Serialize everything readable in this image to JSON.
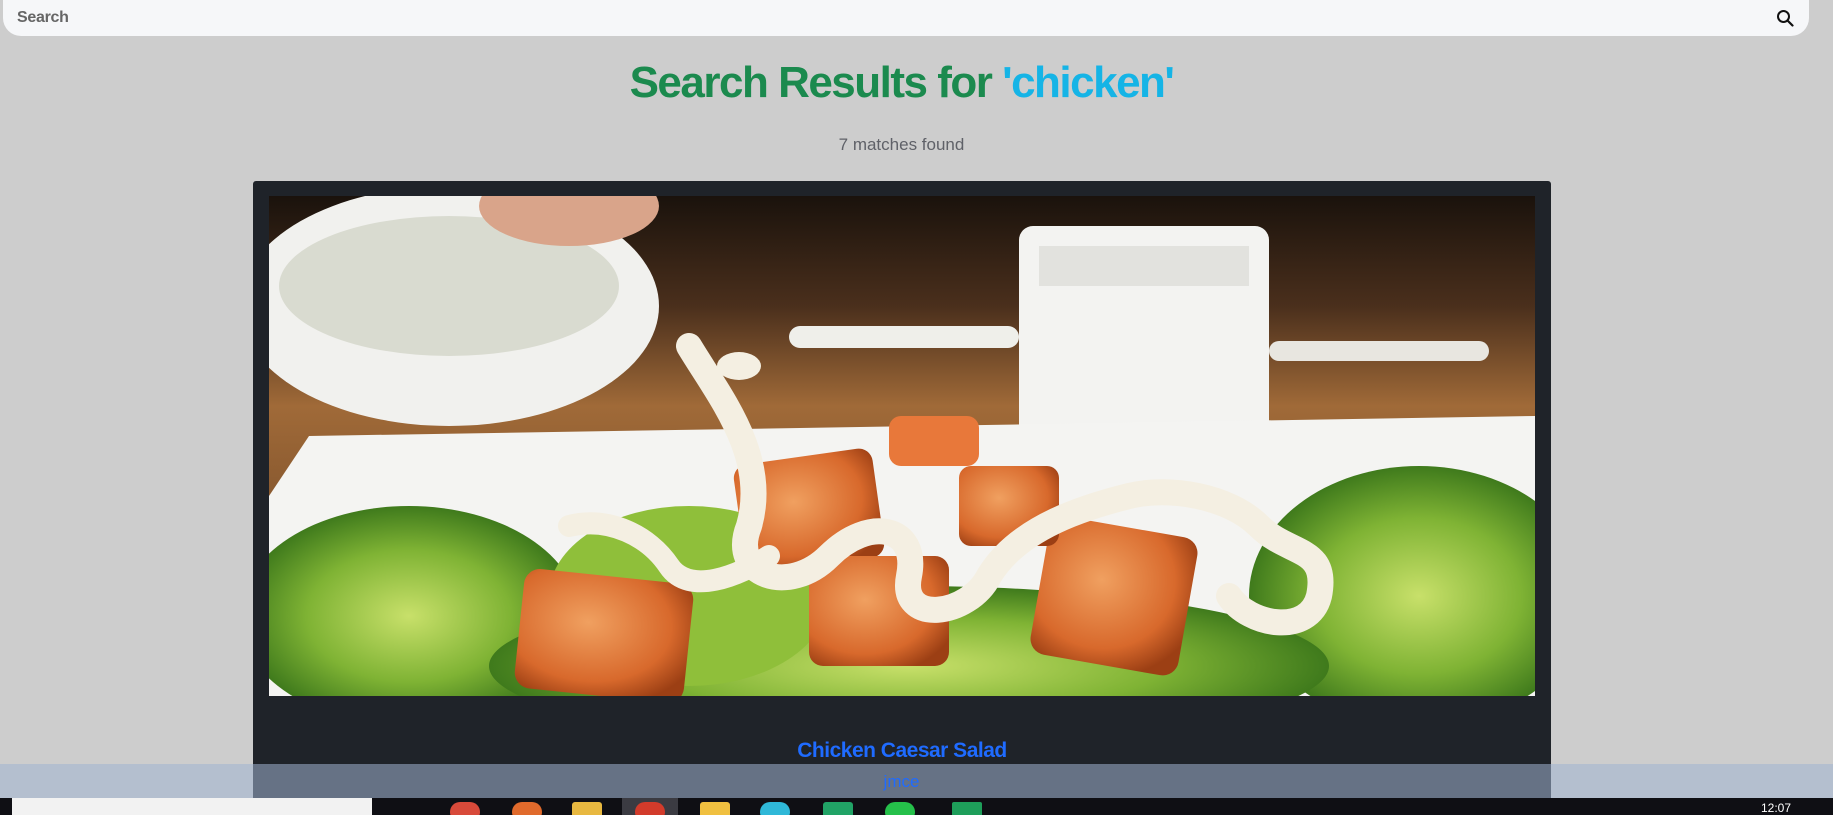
{
  "search": {
    "placeholder": "Search"
  },
  "header": {
    "title_prefix": "Search Results for ",
    "query": "'chicken'",
    "matches": "7 matches found"
  },
  "results": [
    {
      "title": "Chicken Caesar Salad",
      "author": "jmce"
    }
  ],
  "taskbar": {
    "time": "12:07"
  },
  "colors": {
    "title_green": "#1b8a4e",
    "query_cyan": "#15b4e6",
    "link_blue": "#1f6bff",
    "card_bg": "#1f2329",
    "page_bg": "#cdcdcd"
  },
  "icons": [
    "search-icon"
  ]
}
